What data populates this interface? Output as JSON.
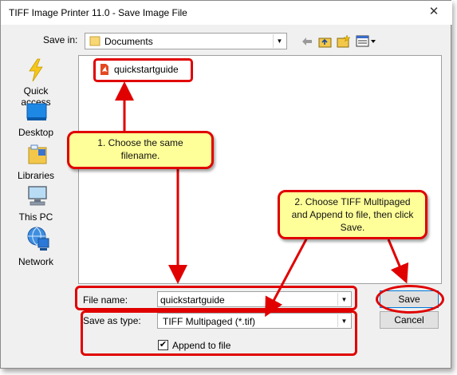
{
  "window": {
    "title": "TIFF Image Printer 11.0 - Save Image File",
    "close_glyph": "✕"
  },
  "toolbar": {
    "save_in_label": "Save in:",
    "save_in_value": "Documents",
    "back_icon": "arrow-left-icon",
    "up_icon": "folder-up-icon",
    "new_folder_icon": "new-folder-icon",
    "view_icon": "view-menu-icon"
  },
  "places": [
    {
      "label": "Quick access",
      "icon": "lightning-icon"
    },
    {
      "label": "Desktop",
      "icon": "desktop-icon"
    },
    {
      "label": "Libraries",
      "icon": "libraries-icon"
    },
    {
      "label": "This PC",
      "icon": "computer-icon"
    },
    {
      "label": "Network",
      "icon": "network-icon"
    }
  ],
  "files": [
    {
      "name": "quickstartguide",
      "icon": "pdf-icon"
    }
  ],
  "form": {
    "file_name_label": "File name:",
    "file_name_value": "quickstartguide",
    "save_as_label": "Save as type:",
    "save_as_value": "TIFF Multipaged (*.tif)",
    "append_label": "Append to file",
    "append_checked": true
  },
  "buttons": {
    "save": "Save",
    "cancel": "Cancel"
  },
  "callouts": {
    "step1": "1. Choose the same filename.",
    "step2": "2. Choose TIFF Multipaged and Append to file, then click Save."
  },
  "colors": {
    "annotation_red": "#e00000",
    "callout_fill": "#ffff99"
  }
}
